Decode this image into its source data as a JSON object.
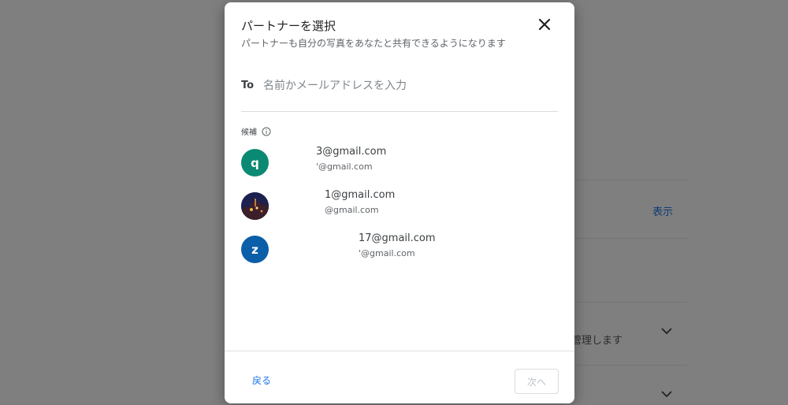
{
  "background": {
    "link_label": "表示",
    "truncated_text": "を管理します"
  },
  "dialog": {
    "title": "パートナーを選択",
    "subtitle": "パートナーも自分の写真をあなたと共有できるようになります",
    "to_label": "To",
    "to_placeholder": "名前かメールアドレスを入力",
    "to_value": "",
    "suggestions_label": "候補",
    "contacts": [
      {
        "avatar_letter": "q",
        "avatar_color": "#0b8a73",
        "name": "3@gmail.com",
        "email": "'@gmail.com"
      },
      {
        "avatar_letter": "",
        "avatar_color": "#2a2a55",
        "name": "1@gmail.com",
        "email": "@gmail.com",
        "avatar_icon": "photo-avatar"
      },
      {
        "avatar_letter": "z",
        "avatar_color": "#0b5ea8",
        "name": "17@gmail.com",
        "email": "'@gmail.com"
      }
    ],
    "back_label": "戻る",
    "next_label": "次へ"
  }
}
